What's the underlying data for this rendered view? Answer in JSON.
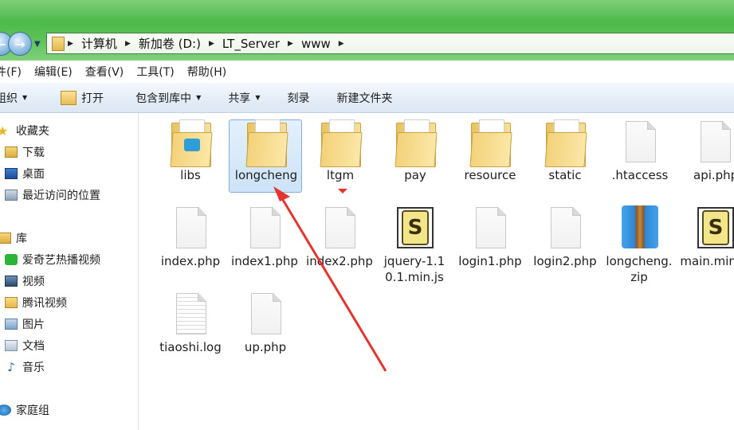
{
  "address": {
    "crumbs": [
      "计算机",
      "新加卷 (D:)",
      "LT_Server",
      "www"
    ]
  },
  "menu": [
    "件(F)",
    "编辑(E)",
    "查看(V)",
    "工具(T)",
    "帮助(H)"
  ],
  "commands": {
    "organize": "组织",
    "open": "打开",
    "include": "包含到库中",
    "share": "共享",
    "burn": "刻录",
    "new_folder": "新建文件夹"
  },
  "sidebar": {
    "favorites": "收藏夹",
    "downloads": "下载",
    "desktop": "桌面",
    "recent": "最近访问的位置",
    "libraries": "库",
    "iqiyi": "爱奇艺热播视频",
    "videos": "视频",
    "tencent": "腾讯视频",
    "pictures": "图片",
    "documents": "文档",
    "music": "音乐",
    "homegroup": "家庭组"
  },
  "files": [
    {
      "name": "libs",
      "type": "folder"
    },
    {
      "name": "longcheng",
      "type": "folder"
    },
    {
      "name": "ltgm",
      "type": "folder"
    },
    {
      "name": "pay",
      "type": "folder"
    },
    {
      "name": "resource",
      "type": "folder"
    },
    {
      "name": "static",
      "type": "folder"
    },
    {
      "name": ".htaccess",
      "type": "file"
    },
    {
      "name": "api.php",
      "type": "file"
    },
    {
      "name": "index.php",
      "type": "file"
    },
    {
      "name": "index1.php",
      "type": "file"
    },
    {
      "name": "index2.php",
      "type": "file"
    },
    {
      "name": "jquery-1.10.1.min.js",
      "type": "script"
    },
    {
      "name": "login1.php",
      "type": "file"
    },
    {
      "name": "login2.php",
      "type": "file"
    },
    {
      "name": "longcheng.zip",
      "type": "zip"
    },
    {
      "name": "main.min.js",
      "type": "script"
    },
    {
      "name": "tiaoshi.log",
      "type": "text"
    },
    {
      "name": "up.php",
      "type": "file"
    }
  ],
  "colors": {
    "aero_green": "#4fb94b",
    "selection": "#cde3f8",
    "annotation_arrow": "#e8322d"
  }
}
